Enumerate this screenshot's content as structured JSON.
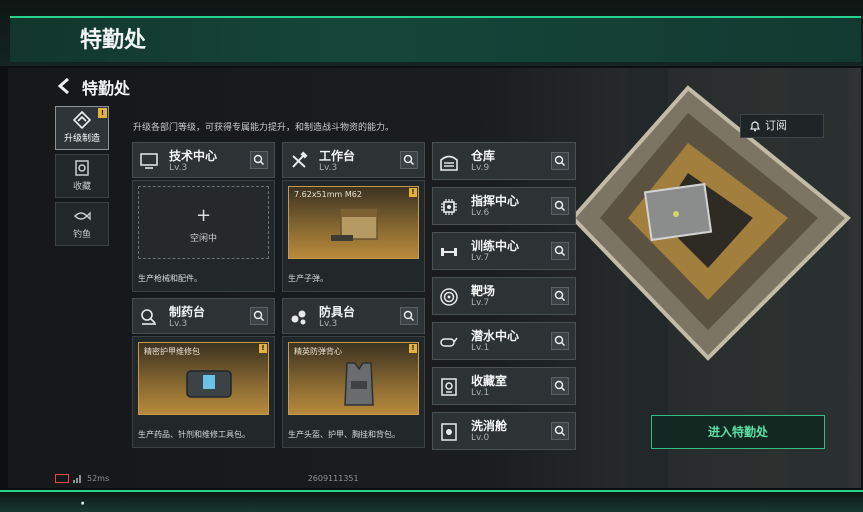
{
  "top_banner": {
    "title": "特勤处"
  },
  "header": {
    "page_title": "特勤处"
  },
  "left_nav": [
    {
      "label": "升级制造",
      "icon": "upgrade-icon",
      "active": true,
      "badge": "!"
    },
    {
      "label": "收藏",
      "icon": "collection-icon",
      "active": false
    },
    {
      "label": "钓鱼",
      "icon": "fishing-icon",
      "active": false
    }
  ],
  "subtitle": "升级各部门等级，可获得专属能力提升，和制造战斗物资的能力。",
  "subscribe_label": "订阅",
  "facilities": [
    {
      "name": "技术中心",
      "level": "Lv.3",
      "icon": "monitor-icon",
      "slot_state": "idle",
      "slot_plus": "+",
      "slot_label": "空闲中",
      "desc": "生产枪械和配件。"
    },
    {
      "name": "工作台",
      "level": "Lv.3",
      "icon": "tools-icon",
      "slot_state": "busy",
      "slot_label": "7.62x51mm M62",
      "slot_badge": "!",
      "desc": "生产子弹。"
    },
    {
      "name": "制药台",
      "level": "Lv.3",
      "icon": "microscope-icon",
      "slot_state": "busy",
      "slot_label": "精密护甲维修包",
      "slot_badge": "!",
      "desc": "生产药品、针剂和维修工具包。"
    },
    {
      "name": "防具台",
      "level": "Lv.3",
      "icon": "armor-icon",
      "slot_state": "busy",
      "slot_label": "精英防弹背心",
      "slot_badge": "!",
      "desc": "生产头盔、护甲、胸挂和背包。"
    }
  ],
  "right_list": [
    {
      "name": "仓库",
      "level": "Lv.9",
      "icon": "warehouse-icon"
    },
    {
      "name": "指挥中心",
      "level": "Lv.6",
      "icon": "chip-icon"
    },
    {
      "name": "训练中心",
      "level": "Lv.7",
      "icon": "dumbbell-icon"
    },
    {
      "name": "靶场",
      "level": "Lv.7",
      "icon": "target-icon"
    },
    {
      "name": "潜水中心",
      "level": "Lv.1",
      "icon": "diving-icon"
    },
    {
      "name": "收藏室",
      "level": "Lv.1",
      "icon": "trophy-icon"
    },
    {
      "name": "洗消舱",
      "level": "Lv.0",
      "icon": "hazard-icon"
    }
  ],
  "enter_button": "进入特勤处",
  "status": {
    "ping": "52ms",
    "uid": "2609111351"
  },
  "bottom_banner_fragment": "·"
}
